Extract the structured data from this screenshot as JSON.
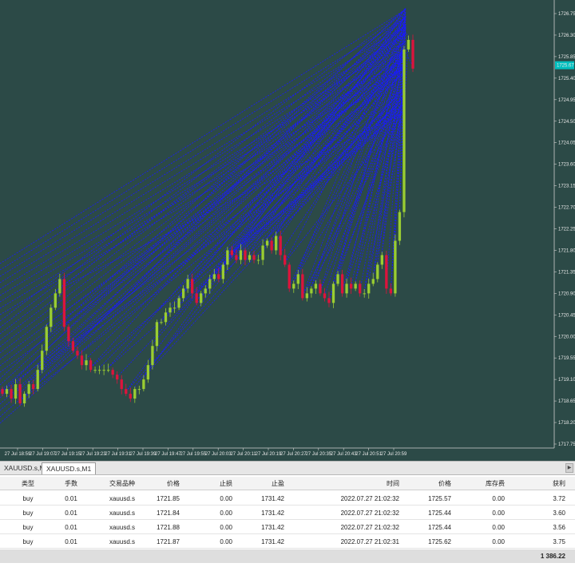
{
  "chart": {
    "price_labels": [
      "1726.75",
      "1726.30",
      "1725.85",
      "1725.40",
      "1724.95",
      "1724.50",
      "1724.05",
      "1723.60",
      "1723.15",
      "1722.70",
      "1722.25",
      "1721.80",
      "1721.35",
      "1720.90",
      "1720.45",
      "1720.00",
      "1719.55",
      "1719.10",
      "1718.65",
      "1718.20",
      "1717.75"
    ],
    "current_price": "1725.67",
    "time_labels": [
      "27 Jul 18:59",
      "27 Jul 19:07",
      "27 Jul 19:15",
      "27 Jul 19:23",
      "27 Jul 19:31",
      "27 Jul 19:39",
      "27 Jul 19:47",
      "27 Jul 19:55",
      "27 Jul 20:03",
      "27 Jul 20:11",
      "27 Jul 20:19",
      "27 Jul 20:27",
      "27 Jul 20:35",
      "27 Jul 20:43",
      "27 Jul 20:51",
      "27 Jul 20:59"
    ],
    "colors": {
      "background": "#2c4a47",
      "bull": "#9acd32",
      "bear": "#dc143c",
      "line": "#1a1aff",
      "axis_text": "#e8e8e8"
    }
  },
  "tabs": [
    {
      "label": "XAUUSD.s,M1",
      "active": false
    },
    {
      "label": "XAUUSD.s,M1",
      "active": true
    }
  ],
  "table": {
    "headers": [
      "类型",
      "手数",
      "交易品种",
      "价格",
      "止损",
      "止盈",
      "时间",
      "价格",
      "库存费",
      "获利"
    ],
    "rows": [
      [
        "buy",
        "0.01",
        "xauusd.s",
        "1721.85",
        "0.00",
        "1731.42",
        "2022.07.27 21:02:32",
        "1725.57",
        "0.00",
        "3.72"
      ],
      [
        "buy",
        "0.01",
        "xauusd.s",
        "1721.84",
        "0.00",
        "1731.42",
        "2022.07.27 21:02:32",
        "1725.44",
        "0.00",
        "3.60"
      ],
      [
        "buy",
        "0.01",
        "xauusd.s",
        "1721.88",
        "0.00",
        "1731.42",
        "2022.07.27 21:02:32",
        "1725.44",
        "0.00",
        "3.56"
      ],
      [
        "buy",
        "0.01",
        "xauusd.s",
        "1721.87",
        "0.00",
        "1731.42",
        "2022.07.27 21:02:31",
        "1725.62",
        "0.00",
        "3.75"
      ]
    ],
    "total": "1 386.22"
  }
}
